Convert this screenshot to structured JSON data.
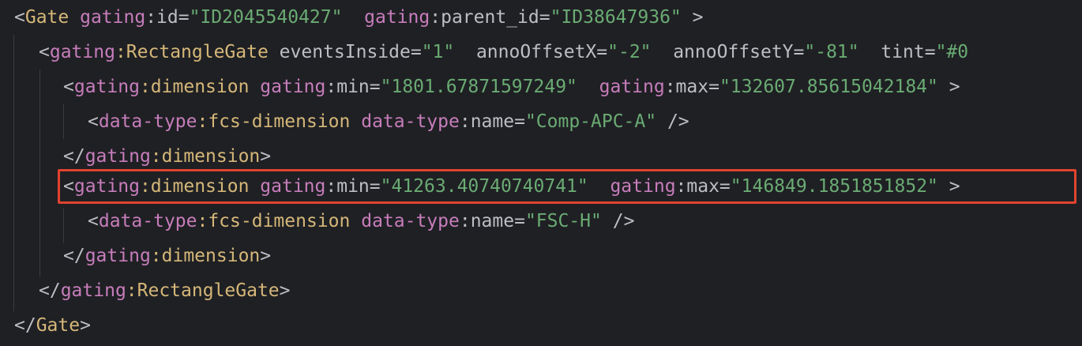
{
  "lines": [
    {
      "tokens": [
        {
          "t": "<",
          "c": "pun"
        },
        {
          "t": "Gate",
          "c": "tag"
        },
        {
          "t": " ",
          "c": "pun"
        },
        {
          "t": "gating",
          "c": "ns"
        },
        {
          "t": ":id=",
          "c": "attr"
        },
        {
          "t": "\"ID2045540427\"",
          "c": "val"
        },
        {
          "t": "  ",
          "c": "pun"
        },
        {
          "t": "gating",
          "c": "ns"
        },
        {
          "t": ":parent_id=",
          "c": "attr"
        },
        {
          "t": "\"ID38647936\"",
          "c": "val"
        },
        {
          "t": " >",
          "c": "pun"
        }
      ]
    },
    {
      "tokens": [
        {
          "t": "<",
          "c": "pun"
        },
        {
          "t": "gating",
          "c": "ns"
        },
        {
          "t": ":RectangleGate",
          "c": "tag"
        },
        {
          "t": " eventsInside=",
          "c": "attr"
        },
        {
          "t": "\"1\"",
          "c": "val"
        },
        {
          "t": "  annoOffsetX=",
          "c": "attr"
        },
        {
          "t": "\"-2\"",
          "c": "val"
        },
        {
          "t": "  annoOffsetY=",
          "c": "attr"
        },
        {
          "t": "\"-81\"",
          "c": "val"
        },
        {
          "t": "  tint=",
          "c": "attr"
        },
        {
          "t": "\"#0",
          "c": "val"
        }
      ]
    },
    {
      "tokens": [
        {
          "t": "<",
          "c": "pun"
        },
        {
          "t": "gating",
          "c": "ns"
        },
        {
          "t": ":dimension",
          "c": "tag"
        },
        {
          "t": " ",
          "c": "pun"
        },
        {
          "t": "gating",
          "c": "ns"
        },
        {
          "t": ":min=",
          "c": "attr"
        },
        {
          "t": "\"1801.67871597249\"",
          "c": "val"
        },
        {
          "t": "  ",
          "c": "pun"
        },
        {
          "t": "gating",
          "c": "ns"
        },
        {
          "t": ":max=",
          "c": "attr"
        },
        {
          "t": "\"132607.85615042184\"",
          "c": "val"
        },
        {
          "t": " >",
          "c": "pun"
        }
      ]
    },
    {
      "tokens": [
        {
          "t": "<",
          "c": "pun"
        },
        {
          "t": "data-type",
          "c": "ns"
        },
        {
          "t": ":fcs-dimension",
          "c": "tag"
        },
        {
          "t": " ",
          "c": "pun"
        },
        {
          "t": "data-type",
          "c": "ns"
        },
        {
          "t": ":name=",
          "c": "attr"
        },
        {
          "t": "\"Comp-APC-A\"",
          "c": "val"
        },
        {
          "t": " />",
          "c": "pun"
        }
      ]
    },
    {
      "tokens": [
        {
          "t": "</",
          "c": "pun"
        },
        {
          "t": "gating",
          "c": "ns"
        },
        {
          "t": ":dimension",
          "c": "tag"
        },
        {
          "t": ">",
          "c": "pun"
        }
      ]
    },
    {
      "tokens": [
        {
          "t": "<",
          "c": "pun"
        },
        {
          "t": "gating",
          "c": "ns"
        },
        {
          "t": ":dimension",
          "c": "tag"
        },
        {
          "t": " ",
          "c": "pun"
        },
        {
          "t": "gating",
          "c": "ns"
        },
        {
          "t": ":min=",
          "c": "attr"
        },
        {
          "t": "\"41263.40740740741\"",
          "c": "val"
        },
        {
          "t": "  ",
          "c": "pun"
        },
        {
          "t": "gating",
          "c": "ns"
        },
        {
          "t": ":max=",
          "c": "attr"
        },
        {
          "t": "\"146849.1851851852\"",
          "c": "val"
        },
        {
          "t": " >",
          "c": "pun"
        }
      ]
    },
    {
      "tokens": [
        {
          "t": "<",
          "c": "pun"
        },
        {
          "t": "data-type",
          "c": "ns"
        },
        {
          "t": ":fcs-dimension",
          "c": "tag"
        },
        {
          "t": " ",
          "c": "pun"
        },
        {
          "t": "data-type",
          "c": "ns"
        },
        {
          "t": ":name=",
          "c": "attr"
        },
        {
          "t": "\"FSC-H\"",
          "c": "val"
        },
        {
          "t": " />",
          "c": "pun"
        }
      ]
    },
    {
      "tokens": [
        {
          "t": "</",
          "c": "pun"
        },
        {
          "t": "gating",
          "c": "ns"
        },
        {
          "t": ":dimension",
          "c": "tag"
        },
        {
          "t": ">",
          "c": "pun"
        }
      ]
    },
    {
      "tokens": [
        {
          "t": "</",
          "c": "pun"
        },
        {
          "t": "gating",
          "c": "ns"
        },
        {
          "t": ":RectangleGate",
          "c": "tag"
        },
        {
          "t": ">",
          "c": "pun"
        }
      ]
    },
    {
      "tokens": [
        {
          "t": "</",
          "c": "pun"
        },
        {
          "t": "Gate",
          "c": "tag"
        },
        {
          "t": ">",
          "c": "pun"
        }
      ]
    }
  ],
  "highlighted_line": 6,
  "colors": {
    "background": "#1f2024",
    "tag": "#d5b778",
    "namespace": "#c77dbb",
    "attribute": "#bcbec4",
    "string": "#6aab73",
    "highlight_border": "#e0432f"
  }
}
